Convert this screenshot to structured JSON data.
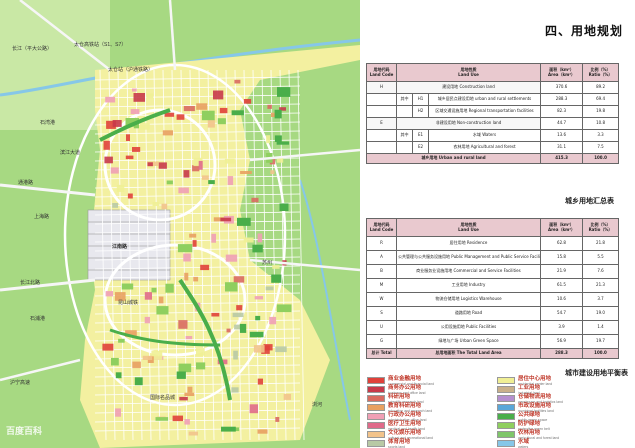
{
  "page_title": "四、用地规划",
  "map": {
    "labels": [
      "太仓高铁站（S1、S7）",
      "太仓站（沪通铁路）",
      "长江（平大公路）",
      "石湾港",
      "通港路",
      "上海路",
      "滨江大道",
      "长江北路",
      "江南路",
      "昆山城铁",
      "石浦港",
      "苏州",
      "国际名品城",
      "沪宁高速",
      "浏河"
    ],
    "watermark": "百度百科"
  },
  "table1": {
    "caption": "城乡用地汇总表",
    "headers": {
      "code_cn": "用地代码",
      "code_en": "Land Code",
      "name_cn": "用地性质",
      "name_en": "Land Use",
      "area_cn": "面积（km²）",
      "area_en": "Area（km²）",
      "ratio_cn": "比例（%）",
      "ratio_en": "Ratio（%）"
    },
    "rows": [
      {
        "code": "H",
        "sub": "",
        "subcode": "",
        "name": "建设用地 Construction land",
        "area": "370.6",
        "ratio": "89.2",
        "kind": "main"
      },
      {
        "code": "",
        "sub": "其中",
        "subcode": "H1",
        "name": "城乡居民点建设用地 urban and rural settlements",
        "area": "288.3",
        "ratio": "69.4",
        "kind": "sub"
      },
      {
        "code": "",
        "sub": "",
        "subcode": "H2",
        "name": "区域交通设施用地 Regional transportation facilities",
        "area": "82.3",
        "ratio": "19.8",
        "kind": "sub"
      },
      {
        "code": "E",
        "sub": "",
        "subcode": "",
        "name": "非建设用地 Non-construction land",
        "area": "44.7",
        "ratio": "10.8",
        "kind": "main"
      },
      {
        "code": "",
        "sub": "其中",
        "subcode": "E1",
        "name": "水域 Waters",
        "area": "13.6",
        "ratio": "3.3",
        "kind": "sub"
      },
      {
        "code": "",
        "sub": "",
        "subcode": "E2",
        "name": "农林用地 Agricultural and forest",
        "area": "31.1",
        "ratio": "7.5",
        "kind": "sub"
      }
    ],
    "total": {
      "name": "城乡用地 Urban and rural land",
      "area": "415.3",
      "ratio": "100.0"
    }
  },
  "table2": {
    "caption": "城市建设用地平衡表",
    "headers": {
      "code_cn": "用地代码",
      "code_en": "Land Code",
      "name_cn": "用地性质",
      "name_en": "Land Use",
      "area_cn": "面积（km²）",
      "area_en": "Area（km²）",
      "ratio_cn": "比例（%）",
      "ratio_en": "Ratio（%）"
    },
    "rows": [
      {
        "code": "R",
        "name": "居住用地 Residence",
        "area": "62.8",
        "ratio": "21.8"
      },
      {
        "code": "A",
        "name": "公共管理与公共服务设施用地 Public Management and Public Service Facilities",
        "area": "15.8",
        "ratio": "5.5"
      },
      {
        "code": "B",
        "name": "商业服务业设施用地 Commercial and Service Facilities",
        "area": "21.9",
        "ratio": "7.6"
      },
      {
        "code": "M",
        "name": "工业用地 Industry",
        "area": "61.5",
        "ratio": "21.3"
      },
      {
        "code": "W",
        "name": "物流仓储用地 Logistics Warehouse",
        "area": "10.6",
        "ratio": "3.7"
      },
      {
        "code": "S",
        "name": "道路用地 Road",
        "area": "54.7",
        "ratio": "19.0"
      },
      {
        "code": "U",
        "name": "公用设施用地 Public Facilities",
        "area": "3.9",
        "ratio": "1.4"
      },
      {
        "code": "G",
        "name": "绿地与广场 Urban Green Space",
        "area": "56.9",
        "ratio": "19.7"
      }
    ],
    "total": {
      "code": "总计 Total",
      "name": "总用地面积 The Total Land Area",
      "area": "288.3",
      "ratio": "100.0"
    }
  },
  "legend": [
    {
      "cn": "商业金融用地",
      "en": "commercial and financial land",
      "color": "#e0413a"
    },
    {
      "cn": "商务办公用地",
      "en": "business and office land",
      "color": "#c8394a"
    },
    {
      "cn": "科研用地",
      "en": "scientific research land",
      "color": "#d96a60"
    },
    {
      "cn": "教育科研用地",
      "en": "education and research land",
      "color": "#e8a060"
    },
    {
      "cn": "行政办公用地",
      "en": "administrative office land",
      "color": "#f09fb5"
    },
    {
      "cn": "医疗卫生用地",
      "en": "medical and health land",
      "color": "#e06a8a"
    },
    {
      "cn": "文化娱乐用地",
      "en": "cultural and recreational land",
      "color": "#f2c38b"
    },
    {
      "cn": "体育用地",
      "en": "sports land",
      "color": "#b8c9a5"
    },
    {
      "cn": "居住中心用地",
      "en": "residential center land",
      "color": "#f0ef95"
    },
    {
      "cn": "工业用地",
      "en": "industrial land",
      "color": "#c9b08a"
    },
    {
      "cn": "仓储物流用地",
      "en": "warehouse and logistics land",
      "color": "#b58fcf"
    },
    {
      "cn": "市政设施用地",
      "en": "municipal facilities land",
      "color": "#5aa7d9"
    },
    {
      "cn": "公共绿地",
      "en": "public green space",
      "color": "#4aae4a"
    },
    {
      "cn": "防护绿地",
      "en": "protective green belt",
      "color": "#8fcf5f"
    },
    {
      "cn": "农林用地",
      "en": "agricultural and forest land",
      "color": "#7fc66a"
    },
    {
      "cn": "水域",
      "en": "waters",
      "color": "#86c7e8"
    }
  ]
}
